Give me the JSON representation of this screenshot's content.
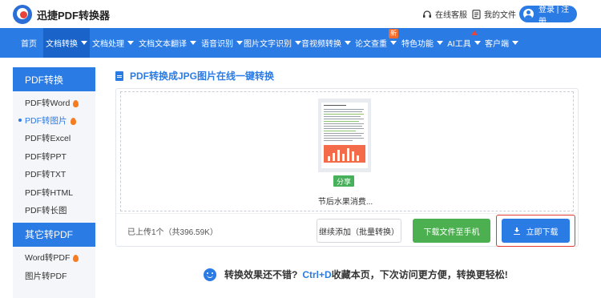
{
  "header": {
    "logo_text": "迅捷PDF转换器",
    "online_service": "在线客服",
    "my_files": "我的文件",
    "login": "登录 | 注册"
  },
  "nav": {
    "items": [
      {
        "label": "首页",
        "has_caret": false
      },
      {
        "label": "文档转换",
        "has_caret": true,
        "active": true
      },
      {
        "label": "文档处理",
        "has_caret": true
      },
      {
        "label": "文档文本翻译",
        "has_caret": true
      },
      {
        "label": "语音识别",
        "has_caret": true
      },
      {
        "label": "图片文字识别",
        "has_caret": true
      },
      {
        "label": "音视频转换",
        "has_caret": true
      },
      {
        "label": "论文查重",
        "has_caret": true
      },
      {
        "label": "特色功能",
        "has_caret": true
      },
      {
        "label": "AI工具",
        "has_caret": true
      },
      {
        "label": "客户端",
        "has_caret": true
      }
    ],
    "new_badge": "新"
  },
  "sidebar": {
    "section1_title": "PDF转换",
    "section1_items": [
      {
        "label": "PDF转Word",
        "hot": true
      },
      {
        "label": "PDF转图片",
        "hot": true,
        "active": true
      },
      {
        "label": "PDF转Excel",
        "hot": false
      },
      {
        "label": "PDF转PPT",
        "hot": false
      },
      {
        "label": "PDF转TXT",
        "hot": false
      },
      {
        "label": "PDF转HTML",
        "hot": false
      },
      {
        "label": "PDF转长图",
        "hot": false
      }
    ],
    "section2_title": "其它转PDF",
    "section2_items": [
      {
        "label": "Word转PDF",
        "hot": true
      },
      {
        "label": "图片转PDF",
        "hot": false
      }
    ]
  },
  "main": {
    "title": "PDF转换成JPG图片在线一键转换",
    "share_label": "分享",
    "file_name": "节后水果消费...",
    "uploaded_text": "已上传1个（共396.59K）",
    "continue_button": "继续添加（批量转换）",
    "phone_button": "下载文件至手机",
    "download_button": "立即下载"
  },
  "tip": {
    "prefix": "转换效果还不错?",
    "highlight": "Ctrl+D",
    "suffix": "收藏本页，下次访问更方便，转换更轻松!"
  },
  "colors": {
    "brand_blue": "#2b7be5",
    "green": "#4caf50",
    "highlight_red": "#e23b2e"
  }
}
